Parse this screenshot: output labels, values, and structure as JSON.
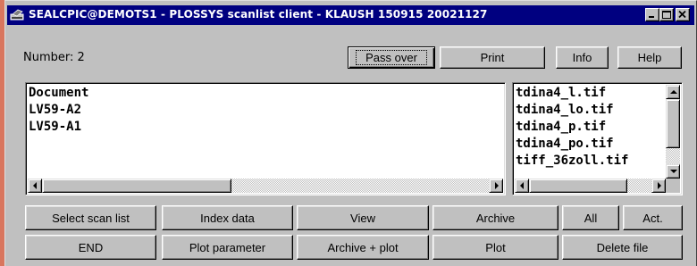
{
  "window": {
    "title": "SEALCPIC@DEMOTS1 - PLOSSYS scanlist client - KLAUSH 150915 20021127",
    "icon": "scanner-app-icon",
    "controls": [
      "minimize",
      "maximize",
      "close"
    ]
  },
  "header": {
    "number_label": "Number: 2",
    "buttons": {
      "pass_over": "Pass over",
      "print": "Print",
      "info": "Info",
      "help": "Help"
    }
  },
  "documents_list": {
    "items": [
      "Document",
      "LV59-A2",
      "LV59-A1"
    ]
  },
  "files_list": {
    "items": [
      "tdina4_l.tif",
      "tdina4_lo.tif",
      "tdina4_p.tif",
      "tdina4_po.tif",
      "tiff_36zoll.tif"
    ]
  },
  "actions": {
    "row1": {
      "select_scan_list": "Select scan list",
      "index_data": "Index data",
      "view": "View",
      "archive": "Archive",
      "all": "All",
      "act": "Act."
    },
    "row2": {
      "end": "END",
      "plot_parameter": "Plot parameter",
      "archive_plot": "Archive + plot",
      "plot": "Plot",
      "delete_file": "Delete file"
    }
  },
  "colors": {
    "titlebar": "#000080",
    "face": "#c0c0c0",
    "desktop": "#d9765e"
  }
}
